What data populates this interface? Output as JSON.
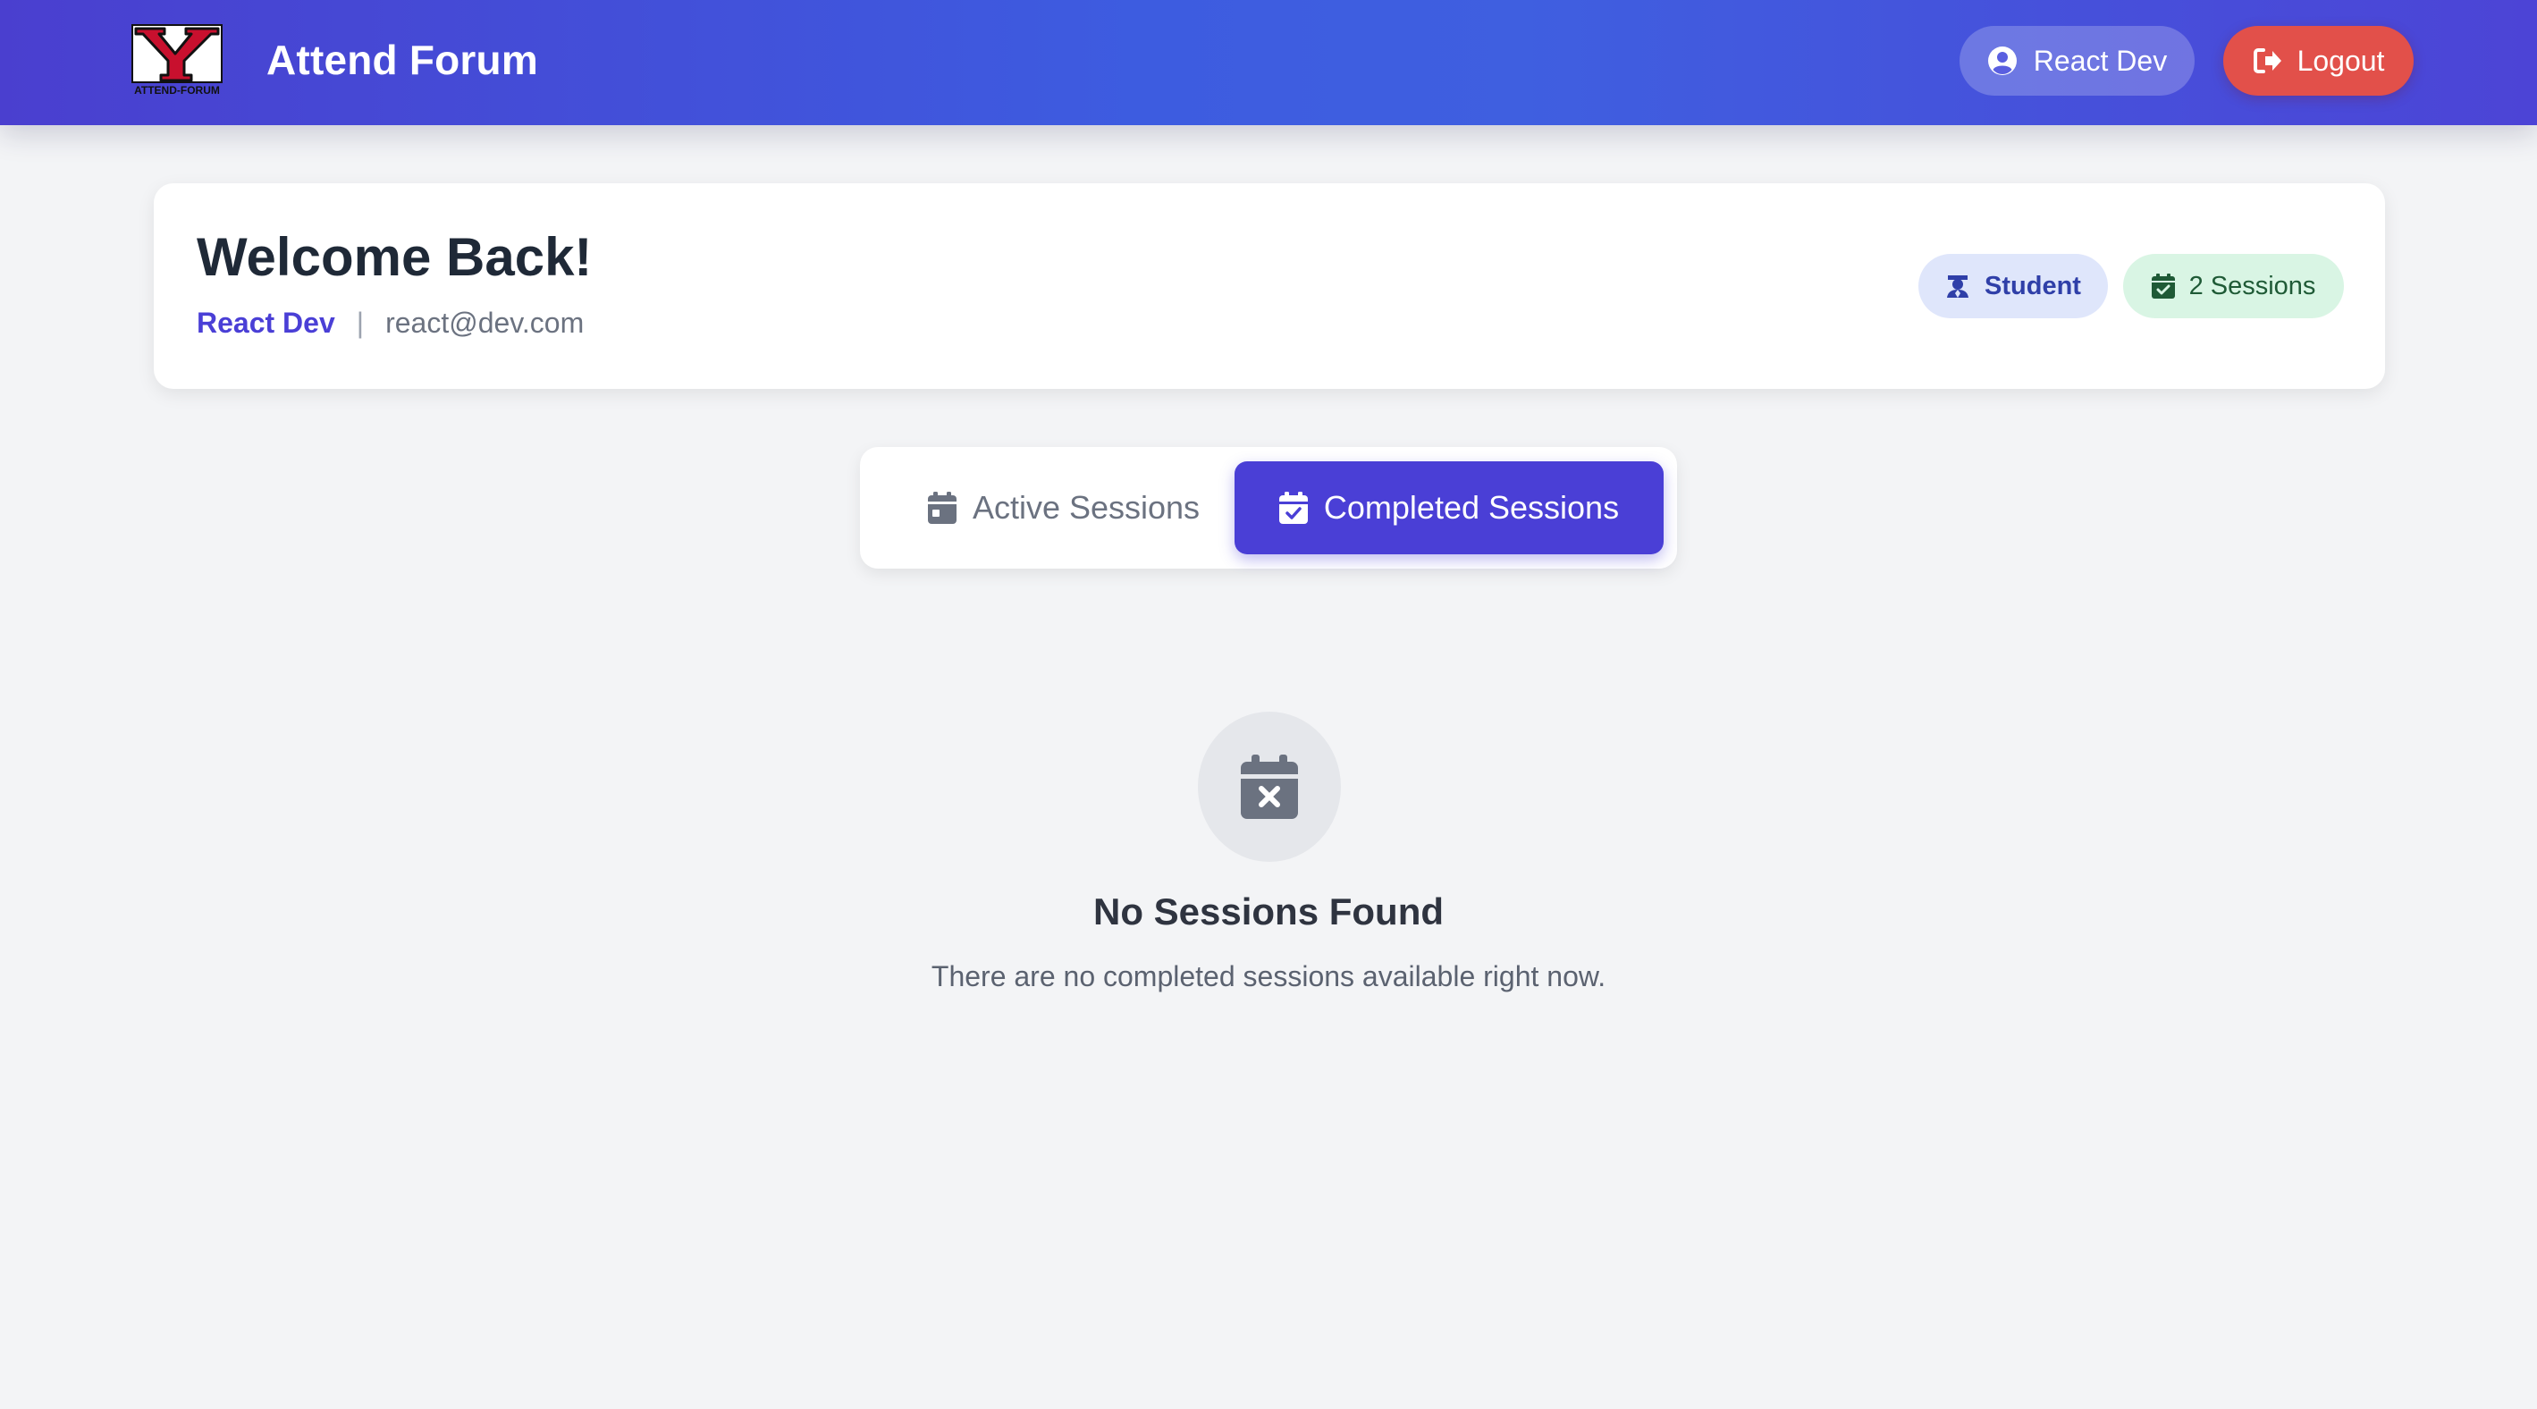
{
  "header": {
    "brand_title": "Attend Forum",
    "logo_caption": "ATTEND-FORUM",
    "logo_letter": "Y",
    "user_label": "React Dev",
    "logout_label": "Logout"
  },
  "welcome": {
    "title": "Welcome Back!",
    "user_name": "React Dev",
    "separator": "|",
    "email": "react@dev.com",
    "role_badge": "Student",
    "sessions_badge": "2 Sessions"
  },
  "tabs": [
    {
      "label": "Active Sessions",
      "selected": false
    },
    {
      "label": "Completed Sessions",
      "selected": true
    }
  ],
  "empty_state": {
    "title": "No Sessions Found",
    "message": "There are no completed sessions available right now."
  },
  "colors": {
    "primary": "#4a3fd6",
    "logout": "#e2504a",
    "role_badge_bg": "#dfe6fb",
    "sessions_badge_bg": "#d9f5e4"
  },
  "icons": {
    "user": "user-circle-icon",
    "logout": "sign-out-icon",
    "role": "graduate-icon",
    "sessions": "calendar-check-icon",
    "active_tab": "calendar-icon",
    "completed_tab": "calendar-check-icon",
    "empty": "calendar-x-icon"
  }
}
